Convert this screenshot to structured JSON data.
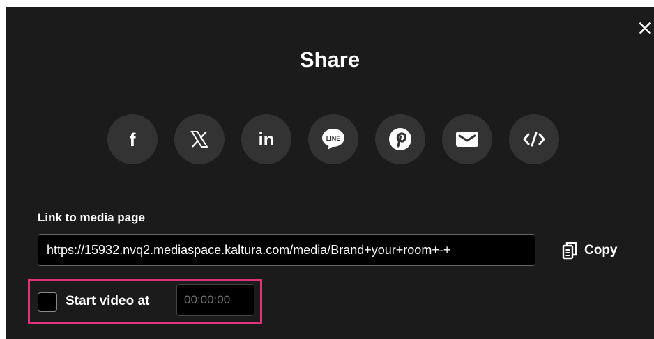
{
  "dialog": {
    "title": "Share",
    "close_icon": "×"
  },
  "social_buttons": [
    {
      "icon": "facebook-icon",
      "glyph": "f"
    },
    {
      "icon": "x-twitter-icon",
      "glyph": "X"
    },
    {
      "icon": "linkedin-icon",
      "glyph": "in"
    },
    {
      "icon": "line-icon",
      "glyph": "LINE"
    },
    {
      "icon": "pinterest-icon",
      "glyph": "P"
    },
    {
      "icon": "email-icon",
      "glyph": "envelope"
    },
    {
      "icon": "embed-code-icon",
      "glyph": "</>"
    }
  ],
  "link": {
    "label": "Link to media page",
    "url": "https://15932.nvq2.mediaspace.kaltura.com/media/Brand+your+room+-+",
    "copy_label": "Copy",
    "copy_icon": "copy-icon"
  },
  "start_video": {
    "label": "Start video at",
    "checked": false,
    "time_placeholder": "00:00:00"
  },
  "colors": {
    "dialog_background": "#1b1b1b",
    "button_background": "#333333",
    "highlight_border": "#e0327a"
  }
}
